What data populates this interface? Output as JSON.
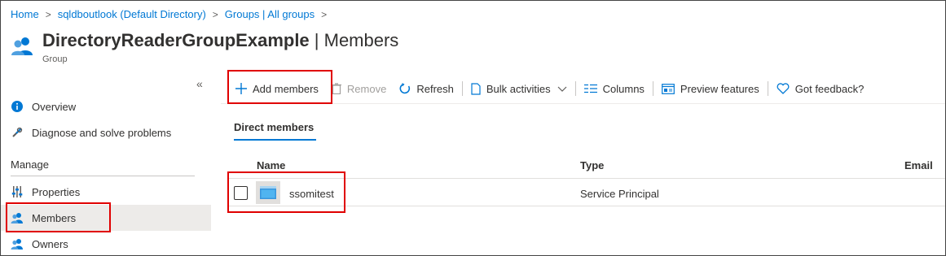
{
  "breadcrumb": {
    "items": [
      "Home",
      "sqldboutlook (Default Directory)",
      "Groups | All groups"
    ],
    "separator": ">"
  },
  "header": {
    "title_main": "DirectoryReaderGroupExample",
    "title_divider": " | ",
    "title_section": "Members",
    "subtitle": "Group"
  },
  "sidebar": {
    "collapse_glyph": "«",
    "items": [
      {
        "label": "Overview",
        "icon": "info-icon"
      },
      {
        "label": "Diagnose and solve problems",
        "icon": "wrench-icon"
      }
    ],
    "section_title": "Manage",
    "manage_items": [
      {
        "label": "Properties",
        "icon": "sliders-icon"
      },
      {
        "label": "Members",
        "icon": "people-icon",
        "selected": true
      },
      {
        "label": "Owners",
        "icon": "people-icon"
      }
    ]
  },
  "toolbar": {
    "add": "Add members",
    "remove": "Remove",
    "refresh": "Refresh",
    "bulk": "Bulk activities",
    "columns": "Columns",
    "preview": "Preview features",
    "feedback": "Got feedback?"
  },
  "tabs": {
    "active": "Direct members"
  },
  "table": {
    "columns": [
      "Name",
      "Type",
      "Email"
    ],
    "rows": [
      {
        "name": "ssomitest",
        "type": "Service Principal",
        "email": ""
      }
    ]
  },
  "colors": {
    "accent": "#0078d4",
    "highlight": "#e00000",
    "selected_bg": "#edebe9"
  }
}
